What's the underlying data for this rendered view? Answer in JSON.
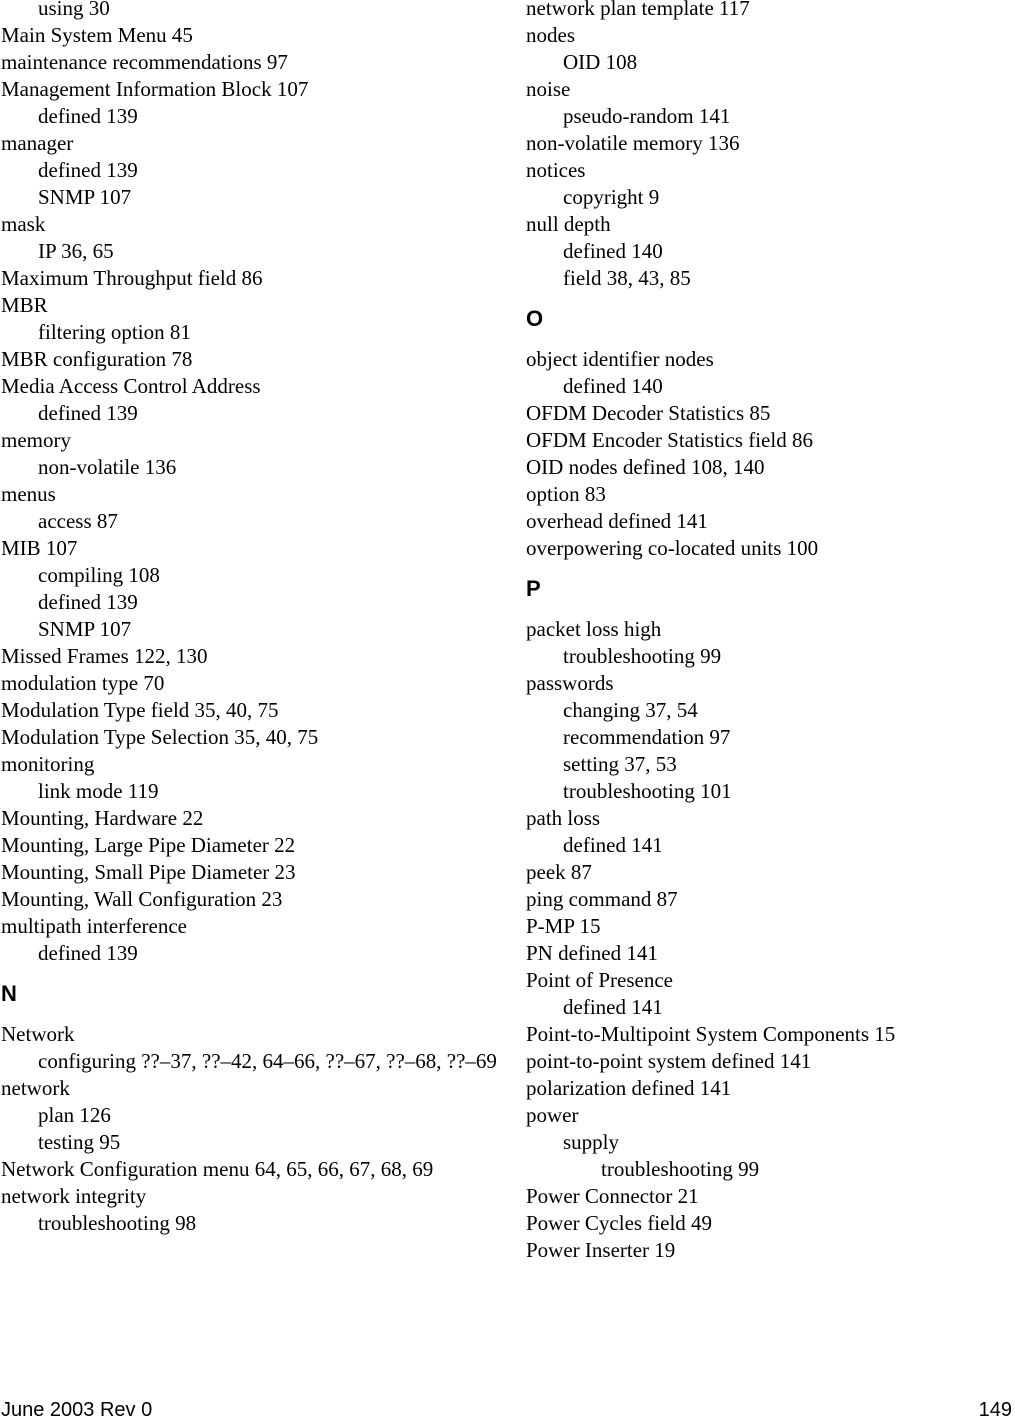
{
  "left_column": [
    {
      "type": "sub",
      "text": "using 30"
    },
    {
      "type": "main",
      "text": "Main System Menu 45"
    },
    {
      "type": "main",
      "text": "maintenance recommendations 97"
    },
    {
      "type": "main",
      "text": "Management Information Block 107"
    },
    {
      "type": "sub",
      "text": "defined 139"
    },
    {
      "type": "main",
      "text": "manager"
    },
    {
      "type": "sub",
      "text": "defined 139"
    },
    {
      "type": "sub",
      "text": "SNMP 107"
    },
    {
      "type": "main",
      "text": "mask"
    },
    {
      "type": "sub",
      "text": "IP 36, 65"
    },
    {
      "type": "main",
      "text": "Maximum Throughput field 86"
    },
    {
      "type": "main",
      "text": "MBR"
    },
    {
      "type": "sub",
      "text": "filtering option 81"
    },
    {
      "type": "main",
      "text": "MBR configuration 78"
    },
    {
      "type": "main",
      "text": "Media Access Control Address"
    },
    {
      "type": "sub",
      "text": "defined 139"
    },
    {
      "type": "main",
      "text": "memory"
    },
    {
      "type": "sub",
      "text": "non-volatile 136"
    },
    {
      "type": "main",
      "text": "menus"
    },
    {
      "type": "sub",
      "text": "access 87"
    },
    {
      "type": "main",
      "text": "MIB 107"
    },
    {
      "type": "sub",
      "text": "compiling 108"
    },
    {
      "type": "sub",
      "text": "defined 139"
    },
    {
      "type": "sub",
      "text": "SNMP 107"
    },
    {
      "type": "main",
      "text": "Missed Frames 122, 130"
    },
    {
      "type": "main",
      "text": "modulation type 70"
    },
    {
      "type": "main",
      "text": "Modulation Type field 35, 40, 75"
    },
    {
      "type": "main",
      "text": "Modulation Type Selection 35, 40, 75"
    },
    {
      "type": "main",
      "text": "monitoring"
    },
    {
      "type": "sub",
      "text": "link mode 119"
    },
    {
      "type": "main",
      "text": "Mounting, Hardware 22"
    },
    {
      "type": "main",
      "text": "Mounting, Large Pipe Diameter 22"
    },
    {
      "type": "main",
      "text": "Mounting, Small Pipe Diameter 23"
    },
    {
      "type": "main",
      "text": "Mounting, Wall Configuration 23"
    },
    {
      "type": "main",
      "text": "multipath interference"
    },
    {
      "type": "sub",
      "text": "defined 139"
    },
    {
      "type": "letter",
      "text": "N"
    },
    {
      "type": "main",
      "text": "Network"
    },
    {
      "type": "wrap",
      "text": "configuring ??–37, ??–42, 64–66, ??–67, ??–68, ??–69"
    },
    {
      "type": "main",
      "text": "network"
    },
    {
      "type": "sub",
      "text": "plan 126"
    },
    {
      "type": "sub",
      "text": "testing 95"
    },
    {
      "type": "main",
      "text": "Network Configuration menu 64, 65, 66, 67, 68, 69"
    },
    {
      "type": "main",
      "text": "network integrity"
    },
    {
      "type": "sub",
      "text": "troubleshooting 98"
    }
  ],
  "right_column": [
    {
      "type": "main",
      "text": "network plan template 117"
    },
    {
      "type": "main",
      "text": "nodes"
    },
    {
      "type": "sub",
      "text": "OID 108"
    },
    {
      "type": "main",
      "text": "noise"
    },
    {
      "type": "sub",
      "text": "pseudo-random 141"
    },
    {
      "type": "main",
      "text": "non-volatile memory 136"
    },
    {
      "type": "main",
      "text": "notices"
    },
    {
      "type": "sub",
      "text": "copyright 9"
    },
    {
      "type": "main",
      "text": "null depth"
    },
    {
      "type": "sub",
      "text": "defined 140"
    },
    {
      "type": "sub",
      "text": "field 38, 43, 85"
    },
    {
      "type": "letter",
      "text": "O"
    },
    {
      "type": "main",
      "text": "object identifier nodes"
    },
    {
      "type": "sub",
      "text": "defined 140"
    },
    {
      "type": "main",
      "text": "OFDM Decoder Statistics 85"
    },
    {
      "type": "main",
      "text": "OFDM Encoder Statistics field 86"
    },
    {
      "type": "main",
      "text": "OID nodes defined 108, 140"
    },
    {
      "type": "main",
      "text": "option 83"
    },
    {
      "type": "main",
      "text": "overhead defined 141"
    },
    {
      "type": "main",
      "text": "overpowering co-located units 100"
    },
    {
      "type": "letter",
      "text": "P"
    },
    {
      "type": "main",
      "text": "packet loss high"
    },
    {
      "type": "sub",
      "text": "troubleshooting 99"
    },
    {
      "type": "main",
      "text": "passwords"
    },
    {
      "type": "sub",
      "text": "changing 37, 54"
    },
    {
      "type": "sub",
      "text": "recommendation 97"
    },
    {
      "type": "sub",
      "text": "setting 37, 53"
    },
    {
      "type": "sub",
      "text": "troubleshooting 101"
    },
    {
      "type": "main",
      "text": "path loss"
    },
    {
      "type": "sub",
      "text": "defined 141"
    },
    {
      "type": "main",
      "text": "peek 87"
    },
    {
      "type": "main",
      "text": "ping command 87"
    },
    {
      "type": "main",
      "text": "P-MP 15"
    },
    {
      "type": "main",
      "text": "PN defined 141"
    },
    {
      "type": "main",
      "text": "Point of Presence"
    },
    {
      "type": "sub",
      "text": "defined 141"
    },
    {
      "type": "main",
      "text": "Point-to-Multipoint System Components 15"
    },
    {
      "type": "main",
      "text": "point-to-point system defined 141"
    },
    {
      "type": "main",
      "text": "polarization defined 141"
    },
    {
      "type": "main",
      "text": "power"
    },
    {
      "type": "sub",
      "text": "supply"
    },
    {
      "type": "subsub",
      "text": "troubleshooting 99"
    },
    {
      "type": "main",
      "text": "Power Connector 21"
    },
    {
      "type": "main",
      "text": "Power Cycles field 49"
    },
    {
      "type": "main",
      "text": "Power Inserter 19"
    }
  ],
  "footer": {
    "left": "June 2003 Rev 0",
    "right": "149"
  }
}
